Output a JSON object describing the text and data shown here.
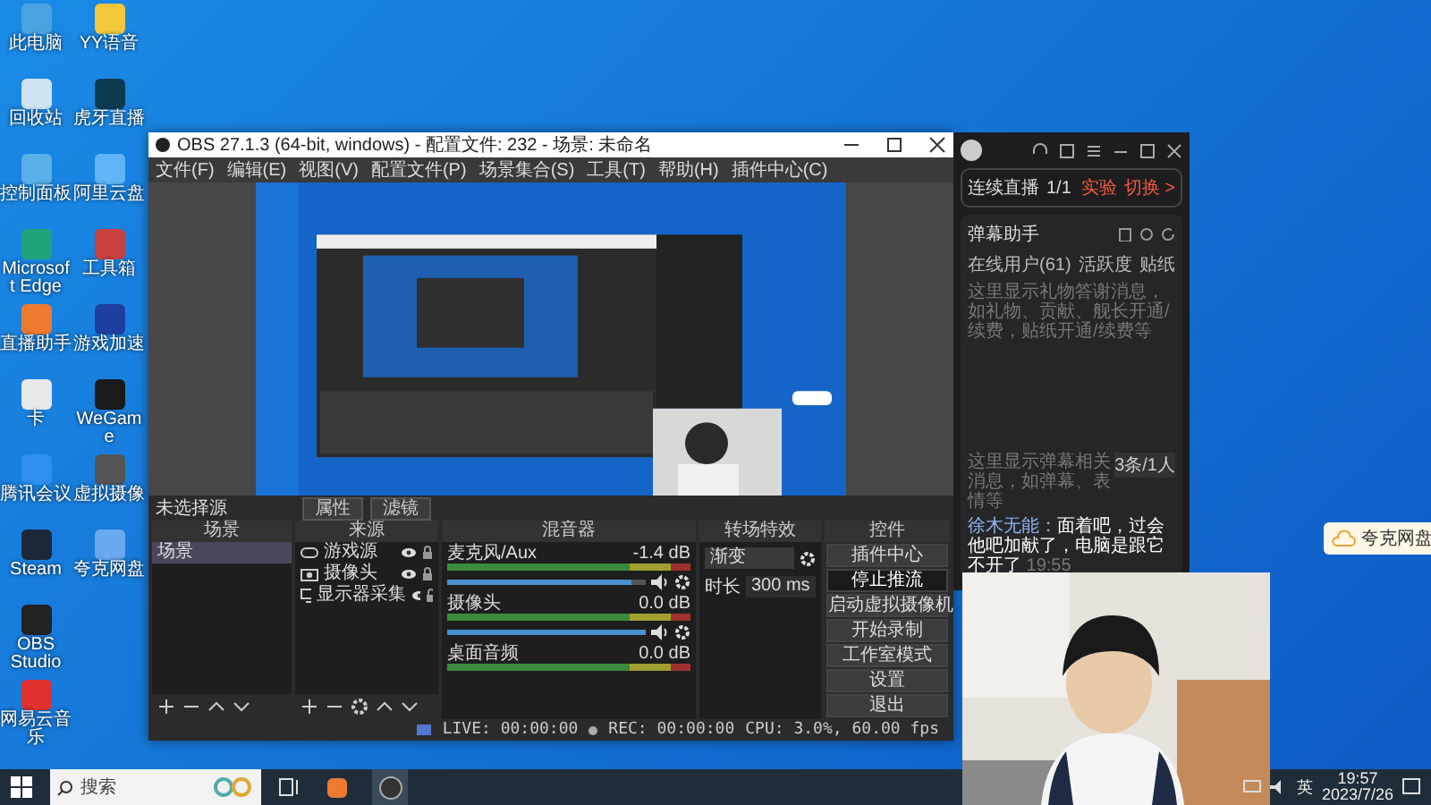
{
  "desktop_icons": [
    {
      "label": "此电脑",
      "color": "#4aa3e0"
    },
    {
      "label": "回收站",
      "color": "#cfe3f0"
    },
    {
      "label": "控制面板",
      "color": "#5ab0e8"
    },
    {
      "label": "Microsoft Edge",
      "color": "#1fa37a"
    },
    {
      "label": "直播助手",
      "color": "#f07a30"
    },
    {
      "label": "卡",
      "color": "#e8e8e8"
    },
    {
      "label": "腾讯会议",
      "color": "#2e8ff0"
    },
    {
      "label": "Steam",
      "color": "#1b2838"
    },
    {
      "label": "OBS Studio",
      "color": "#222222"
    },
    {
      "label": "网易云音乐",
      "color": "#e0302f"
    },
    {
      "label": "YY语音",
      "color": "#f3c83a"
    },
    {
      "label": "虎牙直播",
      "color": "#0d3b52"
    },
    {
      "label": "阿里云盘",
      "color": "#5fb5f5"
    },
    {
      "label": "工具箱",
      "color": "#c84040"
    },
    {
      "label": "游戏加速",
      "color": "#1f3fa0"
    },
    {
      "label": "WeGame",
      "color": "#1a1a1a"
    },
    {
      "label": "虚拟摄像",
      "color": "#555555"
    },
    {
      "label": "夸克网盘",
      "color": "#6aa8f0"
    }
  ],
  "obs": {
    "title": "OBS 27.1.3 (64-bit, windows) - 配置文件: 232 - 场景: 未命名",
    "menu": [
      "文件(F)",
      "编辑(E)",
      "视图(V)",
      "配置文件(P)",
      "场景集合(S)",
      "工具(T)",
      "帮助(H)",
      "插件中心(C)"
    ],
    "source_bar": {
      "label": "未选择源",
      "buttons": [
        "属性",
        "滤镜"
      ]
    },
    "scenes": {
      "title": "场景",
      "items": [
        {
          "label": "场景",
          "selected": true
        }
      ]
    },
    "sources": {
      "title": "来源",
      "items": [
        {
          "label": "游戏源",
          "kind": "game"
        },
        {
          "label": "摄像头",
          "kind": "camera"
        },
        {
          "label": "显示器采集",
          "kind": "display"
        }
      ]
    },
    "mixer": {
      "title": "混音器",
      "channels": [
        {
          "name": "麦克风/Aux",
          "reading": "-1.4 dB",
          "level": 0.93
        },
        {
          "name": "摄像头",
          "reading": "0.0 dB",
          "level": 1
        },
        {
          "name": "桌面音频",
          "reading": "0.0 dB"
        }
      ]
    },
    "transitions": {
      "title": "转场特效",
      "selected": "渐变",
      "duration_label": "时长",
      "duration": "300 ms"
    },
    "controls": {
      "title": "控件",
      "buttons": [
        {
          "label": "插件中心",
          "active": false
        },
        {
          "label": "停止推流",
          "active": true
        },
        {
          "label": "启动虚拟摄像机",
          "active": false
        },
        {
          "label": "开始录制",
          "active": false
        },
        {
          "label": "工作室模式",
          "active": false
        },
        {
          "label": "设置",
          "active": false
        },
        {
          "label": "退出",
          "active": false
        }
      ]
    },
    "status_bar": {
      "live": "LIVE: 00:00:00",
      "rec": "REC: 00:00:00",
      "cpu": "CPU: 3.0%, 60.00 fps"
    }
  },
  "assistant": {
    "live_label": "连续直播",
    "live_count": "1/1",
    "badge": "实验",
    "switch": "切换 >",
    "title": "弹幕助手",
    "tabs": [
      "在线用户(61)",
      "活跃度",
      "贴纸"
    ],
    "notice_1": "这里显示礼物答谢消息，如礼物、贡献、舰长开通/续费，贴纸开通/续费等",
    "notice_2": "这里显示弹幕相关消息，如弹幕、表情等",
    "count": "3条/1人",
    "messages": [
      {
        "user": "徐木无能：",
        "text": "面着吧，过会他吧加献了，电脑是跟它不开了",
        "time": "19:55"
      }
    ]
  },
  "cloud_popup": "夸克网盘",
  "taskbar": {
    "search": "搜索",
    "ime": "英",
    "time": "19:57",
    "date": "2023/7/26"
  }
}
